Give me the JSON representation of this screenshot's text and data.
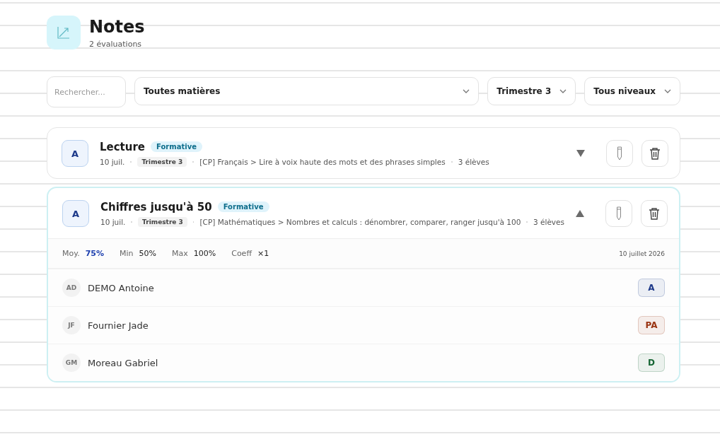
{
  "header": {
    "title": "Notes",
    "subtitle": "2 évaluations"
  },
  "filters": {
    "search": {
      "placeholder": "Rechercher..."
    },
    "selects": [
      {
        "label": "Toutes matières"
      },
      {
        "label": "Trimestre 3"
      },
      {
        "label": "Tous niveaux"
      }
    ]
  },
  "evaluations": [
    {
      "grade": "A",
      "title": "Lecture",
      "tag": "Formative",
      "date": "10 juil.",
      "period": "Trimestre 3",
      "subject": "[CP] Français > Lire à voix haute des mots et des phrases simples",
      "students_count": "3 élèves",
      "expanded": false
    },
    {
      "grade": "A",
      "title": "Chiffres jusqu'à 50",
      "tag": "Formative",
      "date": "10 juil.",
      "period": "Trimestre 3",
      "subject": "[CP] Mathématiques > Nombres et calculs : dénombrer, comparer, ranger jusqu'à 100",
      "students_count": "3 élèves",
      "expanded": true,
      "stats": [
        {
          "label": "Moy.",
          "value": "75%",
          "highlighted": true
        },
        {
          "label": "Min",
          "value": "50%",
          "highlighted": false
        },
        {
          "label": "Max",
          "value": "100%",
          "highlighted": false
        },
        {
          "label": "Coeff",
          "value": "×1",
          "highlighted": false
        }
      ],
      "full_date": "10 juillet 2026",
      "students": [
        {
          "initials": "AD",
          "name": "DEMO Antoine",
          "grade": "A",
          "color": "#1e3a8a"
        },
        {
          "initials": "JF",
          "name": "Fournier Jade",
          "grade": "PA",
          "color": "#9a3412"
        },
        {
          "initials": "GM",
          "name": "Moreau Gabriel",
          "grade": "D",
          "color": "#166534"
        }
      ]
    }
  ]
}
